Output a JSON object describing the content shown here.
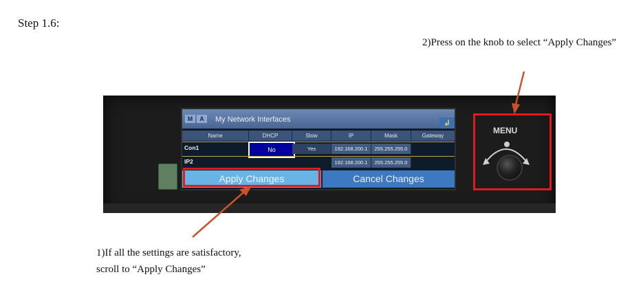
{
  "step_title": "Step 1.6:",
  "notes": {
    "press_knob": "2)Press on the knob to select “Apply Changes”",
    "scroll": "1)If all the settings are satisfactory, scroll to “Apply Changes”"
  },
  "screen": {
    "logo": [
      "M",
      "A"
    ],
    "title": "My Network Interfaces",
    "back_icon": "back-arrow-icon",
    "columns": [
      "Name",
      "DHCP",
      "Slow",
      "IP",
      "Mask",
      "Gateway"
    ],
    "rows": [
      {
        "name": "Con1",
        "dhcp": "No",
        "slow": "Yes",
        "ip": "192.168.200.1",
        "mask": "255.255.255.0",
        "gateway": ""
      },
      {
        "name": "IP2",
        "dhcp": "",
        "slow": "",
        "ip": "192.168.200.1",
        "mask": "255.255.255.0",
        "gateway": ""
      }
    ],
    "apply_button": "Apply Changes",
    "cancel_button": "Cancel Changes"
  },
  "device": {
    "menu_label": "MENU"
  },
  "colors": {
    "highlight_box": "#e01b1b",
    "arrow": "#c8532a",
    "apply_button": "#69b4e6",
    "cancel_button": "#3c79c0",
    "selected_cell": "#0000a0"
  }
}
